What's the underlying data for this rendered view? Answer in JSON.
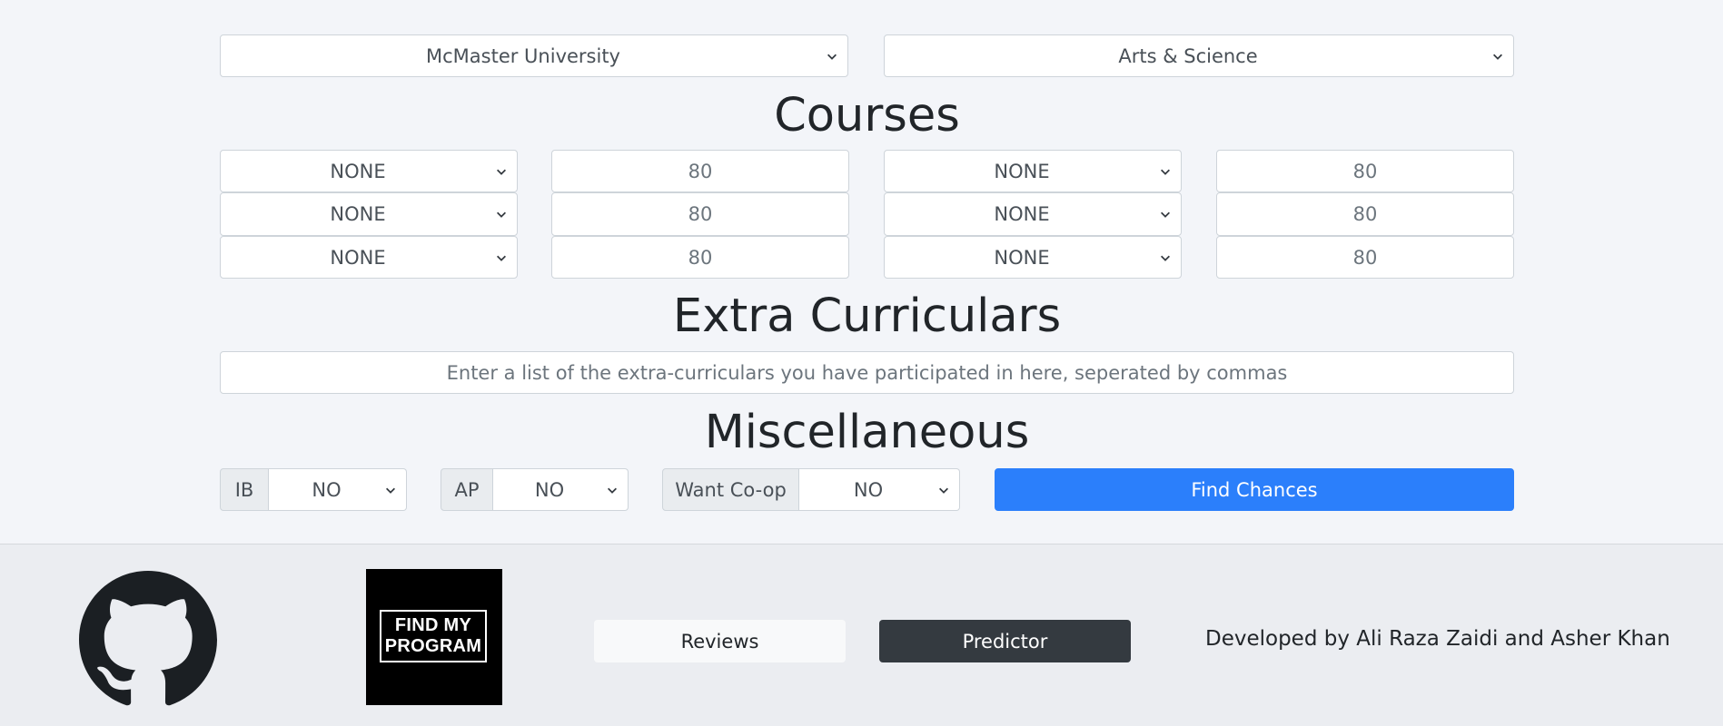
{
  "selectors": {
    "university": "McMaster University",
    "program": "Arts & Science"
  },
  "courses": {
    "heading": "Courses",
    "rows": [
      {
        "course_a": "NONE",
        "grade_a": "80",
        "course_b": "NONE",
        "grade_b": "80"
      },
      {
        "course_a": "NONE",
        "grade_a": "80",
        "course_b": "NONE",
        "grade_b": "80"
      },
      {
        "course_a": "NONE",
        "grade_a": "80",
        "course_b": "NONE",
        "grade_b": "80"
      }
    ]
  },
  "extracurriculars": {
    "heading": "Extra Curriculars",
    "placeholder": "Enter a list of the extra-curriculars you have participated in here, seperated by commas"
  },
  "misc": {
    "heading": "Miscellaneous",
    "ib": {
      "label": "IB",
      "value": "NO"
    },
    "ap": {
      "label": "AP",
      "value": "NO"
    },
    "coop": {
      "label": "Want Co-op",
      "value": "NO"
    },
    "submit": "Find Chances"
  },
  "footer": {
    "github_icon": "github-icon",
    "logo_text": "FIND MY PROGRAM",
    "reviews": "Reviews",
    "predictor": "Predictor",
    "credit": "Developed by Ali Raza Zaidi and Asher Khan"
  },
  "colors": {
    "page_bg": "#f3f5f9",
    "footer_bg": "#ebedf1",
    "primary": "#2b7ffb",
    "dark": "#343a40"
  }
}
